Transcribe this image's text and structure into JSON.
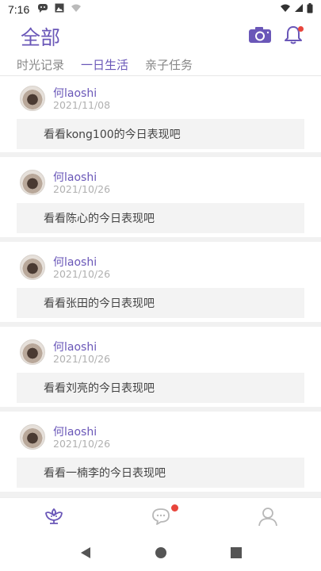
{
  "status_bar": {
    "time": "7:16",
    "left_icons": [
      "message-notification-icon",
      "image-notification-icon",
      "wifi-off-icon"
    ],
    "right_icons": [
      "wifi-icon",
      "cell-signal-icon",
      "battery-icon"
    ]
  },
  "header": {
    "title": "全部",
    "camera_icon": "camera-icon",
    "bell_icon": "bell-icon",
    "accent_color": "#6a57b8",
    "badge_color": "#e8453c"
  },
  "tabs": [
    {
      "label": "时光记录",
      "active": false
    },
    {
      "label": "一日生活",
      "active": true
    },
    {
      "label": "亲子任务",
      "active": false
    }
  ],
  "feed": [
    {
      "author": "何laoshi",
      "date": "2021/11/08",
      "message": "看看kong100的今日表现吧"
    },
    {
      "author": "何laoshi",
      "date": "2021/10/26",
      "message": "看看陈心的今日表现吧"
    },
    {
      "author": "何laoshi",
      "date": "2021/10/26",
      "message": "看看张田的今日表现吧"
    },
    {
      "author": "何laoshi",
      "date": "2021/10/26",
      "message": "看看刘亮的今日表现吧"
    },
    {
      "author": "何laoshi",
      "date": "2021/10/26",
      "message": "看看一楠李的今日表现吧"
    }
  ],
  "bottom_nav": [
    {
      "icon": "flower-home-icon",
      "active": true
    },
    {
      "icon": "chat-bubble-icon",
      "active": false,
      "has_badge": true
    },
    {
      "icon": "profile-icon",
      "active": false
    }
  ],
  "system_nav": [
    "back-icon",
    "home-icon",
    "recents-icon"
  ]
}
